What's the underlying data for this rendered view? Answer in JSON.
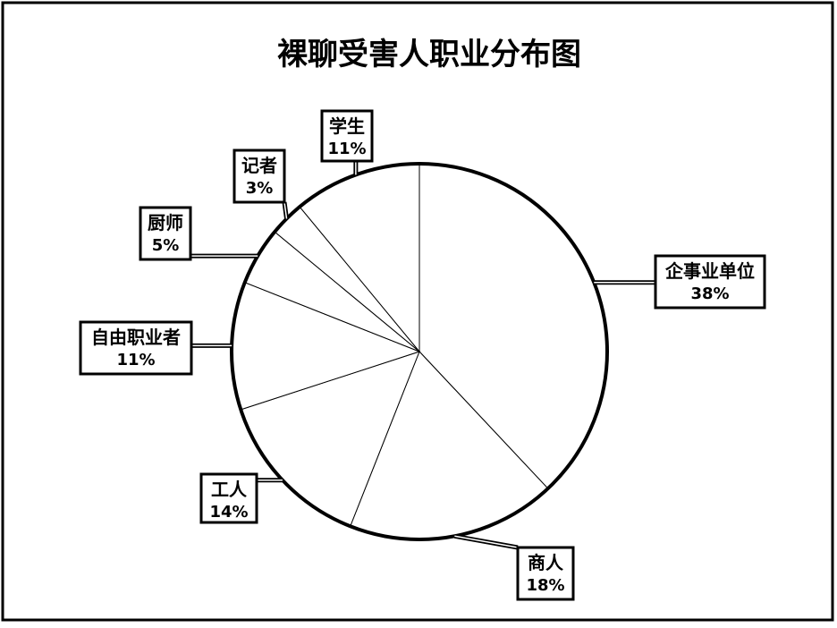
{
  "chart_data": {
    "type": "pie",
    "title": "裸聊受害人职业分布图",
    "slices": [
      {
        "label": "企事业单位",
        "value": 38,
        "value_label": "38%"
      },
      {
        "label": "商人",
        "value": 18,
        "value_label": "18%"
      },
      {
        "label": "工人",
        "value": 14,
        "value_label": "14%"
      },
      {
        "label": "自由职业者",
        "value": 11,
        "value_label": "11%"
      },
      {
        "label": "厨师",
        "value": 5,
        "value_label": "5%"
      },
      {
        "label": "记者",
        "value": 3,
        "value_label": "3%"
      },
      {
        "label": "学生",
        "value": 11,
        "value_label": "11%"
      }
    ],
    "legend": "none",
    "colors": {
      "fill": "#ffffff",
      "stroke": "#000000"
    }
  }
}
